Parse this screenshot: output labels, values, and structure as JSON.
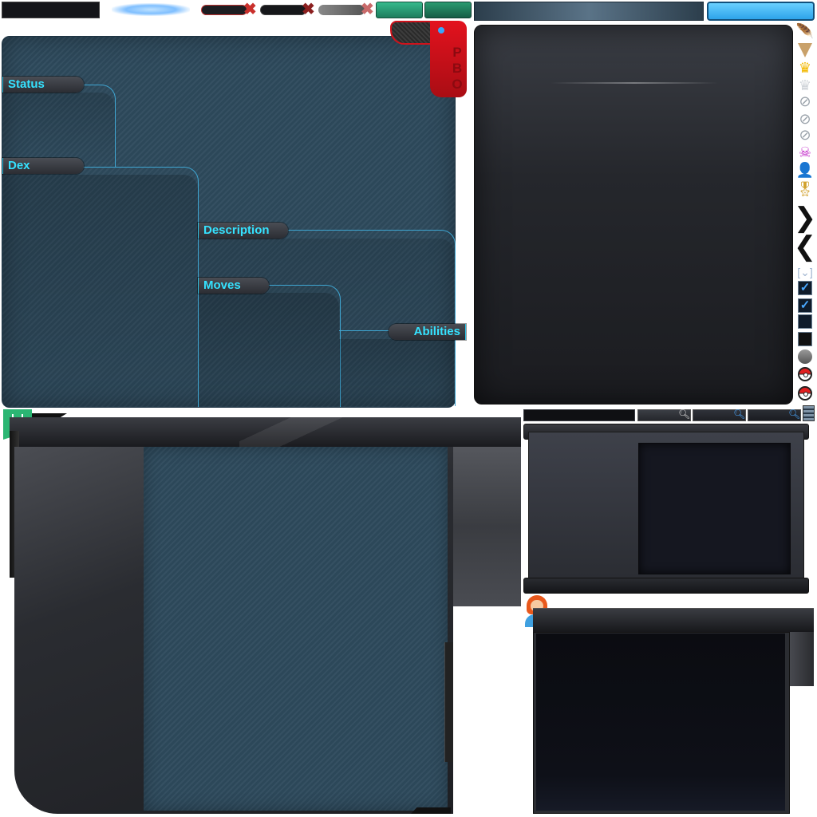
{
  "panel_tabs": {
    "status": "Status",
    "dex": "Dex",
    "description": "Description",
    "moves": "Moves",
    "abilities": "Abilities"
  },
  "badge": {
    "letters": [
      "P",
      "B",
      "O"
    ]
  },
  "sprites": {
    "feather": "feather-icon",
    "drill": "drill-icon",
    "crown_gold": "crown-gold-icon",
    "crown_silver": "crown-silver-icon",
    "skull": "skull-icon",
    "person": "person-icon",
    "medal": "medal-icon",
    "arrow_right": "chevron-right-icon",
    "arrow_left": "chevron-left-icon",
    "checkbox_checked": "checkbox-checked-icon",
    "checkbox_empty": "checkbox-empty-icon",
    "pokeball": "pokeball-icon"
  },
  "colors": {
    "tab_text": "#35e2ff",
    "panel_blue": "#2e4a5c",
    "accent_red": "#d0121b",
    "bright_blue_button": "#3fb6f3",
    "green_button": "#2aa07a"
  }
}
